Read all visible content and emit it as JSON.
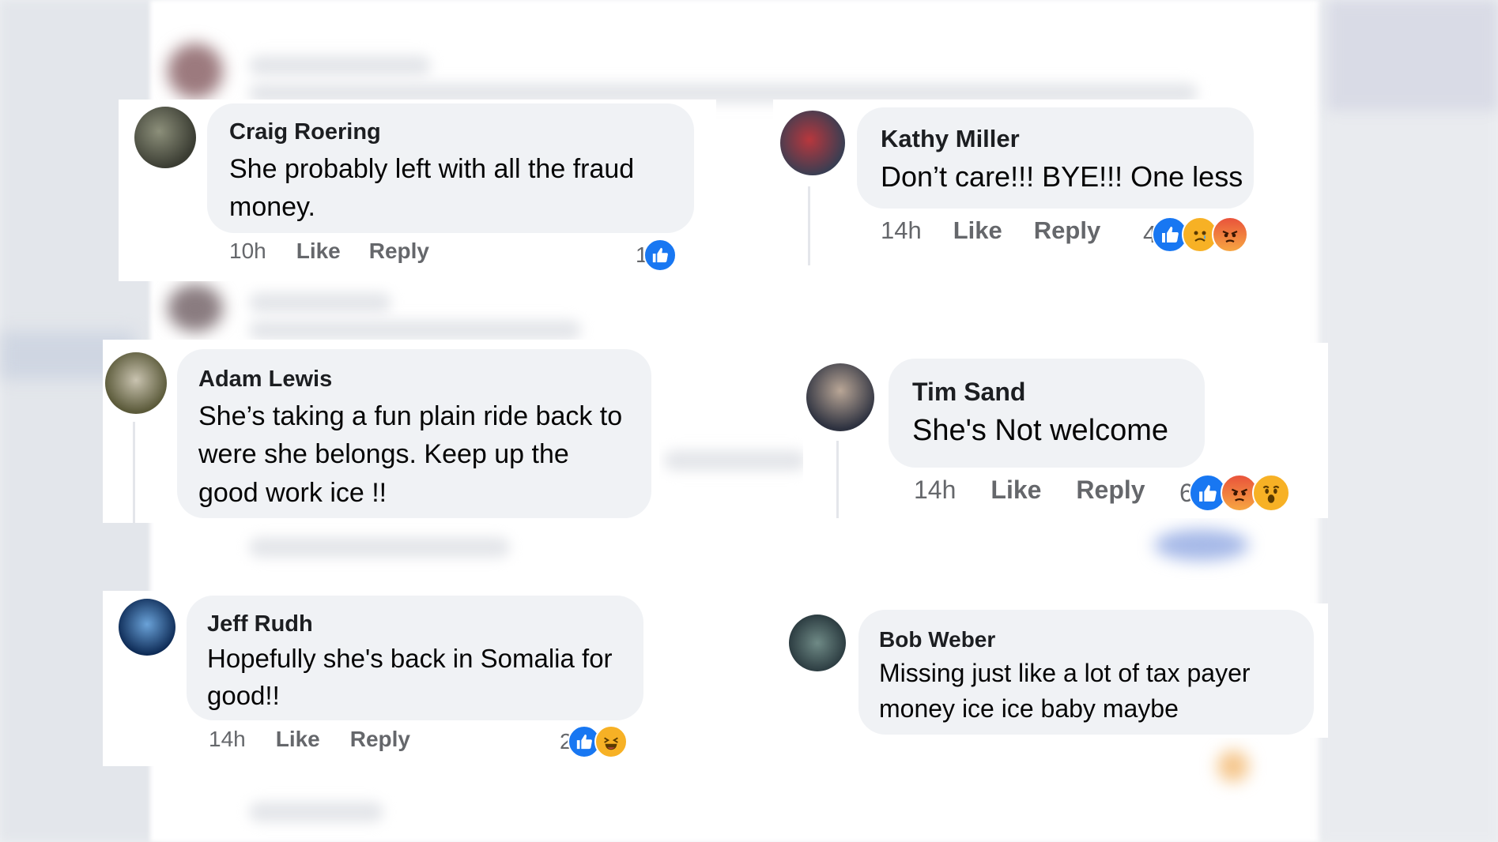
{
  "comments": [
    {
      "name": "Craig Roering",
      "text": "She probably left with all the fraud money.",
      "time": "10h",
      "like_label": "Like",
      "reply_label": "Reply",
      "reaction_count": "1",
      "reactions": [
        "like"
      ]
    },
    {
      "name": "Kathy Miller",
      "text": "Don’t care!!! BYE!!! One less",
      "time": "14h",
      "like_label": "Like",
      "reply_label": "Reply",
      "reaction_count": "4",
      "reactions": [
        "like",
        "sad",
        "angry"
      ]
    },
    {
      "name": "Adam Lewis",
      "text": "She’s taking a fun plain ride back to were she belongs. Keep up the good work ice !!",
      "reactions": []
    },
    {
      "name": "Tim Sand",
      "text": "She's Not welcome",
      "time": "14h",
      "like_label": "Like",
      "reply_label": "Reply",
      "reaction_count": "6",
      "reactions": [
        "like",
        "angry",
        "wow"
      ]
    },
    {
      "name": "Jeff Rudh",
      "text": "Hopefully she's back in Somalia for good!!",
      "time": "14h",
      "like_label": "Like",
      "reply_label": "Reply",
      "reaction_count": "2",
      "reactions": [
        "like",
        "haha"
      ]
    },
    {
      "name": "Bob Weber",
      "text": "Missing just like a lot of tax payer money ice ice baby maybe",
      "reactions": []
    }
  ],
  "colors": {
    "like": "#1877f2",
    "sad": "#f7b125",
    "angry": "#e9533b",
    "bubble": "#f0f2f5"
  }
}
